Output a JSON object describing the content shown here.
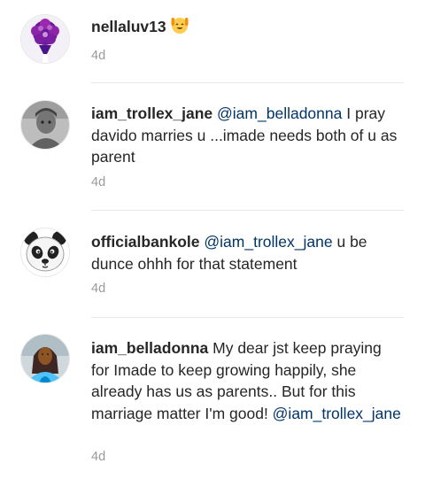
{
  "comments": [
    {
      "username": "nellaluv13",
      "mention": "",
      "text": "",
      "emoji": "smiling-face-with-raised-hands-emoji",
      "time": "4d"
    },
    {
      "username": "iam_trollex_jane",
      "mention": "@iam_belladonna",
      "text": " I pray davido marries u ...imade needs both of u as parent",
      "time": "4d"
    },
    {
      "username": "officialbankole",
      "mention": "@iam_trollex_jane",
      "text": " u be dunce ohhh for that statement",
      "time": "4d"
    },
    {
      "username": "iam_belladonna",
      "text": " My dear jst keep praying for Imade to keep growing happily, she already has us as parents.. But for this marriage matter I'm good! ",
      "mention": "@iam_trollex_jane",
      "time": "4d"
    }
  ],
  "colors": {
    "text": "#262626",
    "mention": "#003569",
    "timestamp": "#999999",
    "divider": "#e6e6e6"
  }
}
